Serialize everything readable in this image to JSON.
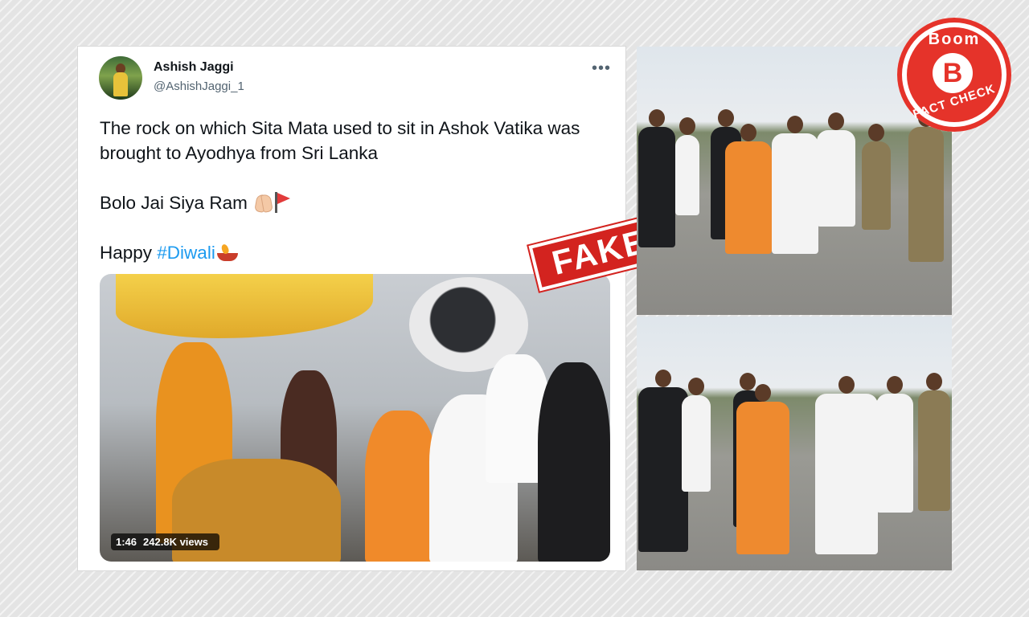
{
  "tweet": {
    "name": "Ashish Jaggi",
    "handle": "@AshishJaggi_1",
    "more_icon": "more-icon",
    "line1": "The rock on which Sita Mata used to sit in Ashok Vatika was brought to Ayodhya from Sri Lanka",
    "line2": "Bolo Jai Siya Ram",
    "line3_prefix": "Happy ",
    "hashtag": "#Diwali",
    "video": {
      "duration": "1:46",
      "views": "242.8K views"
    }
  },
  "stamp": {
    "label": "FAKE",
    "color": "#d3231f"
  },
  "logo": {
    "top_text": "Boom",
    "bottom_text": "FACT CHECK",
    "letter": "B",
    "color": "#e5332a"
  },
  "colors": {
    "hashtag": "#1d9bf0",
    "text": "#0f1419",
    "muted": "#536471"
  }
}
